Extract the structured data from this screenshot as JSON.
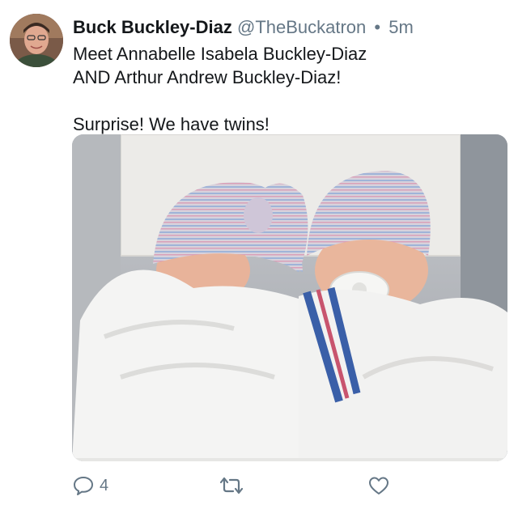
{
  "tweet": {
    "author": {
      "display_name": "Buck Buckley-Diaz",
      "handle": "@TheBuckatron",
      "separator": "•",
      "time": "5m"
    },
    "text": {
      "line1": "Meet Annabelle Isabela Buckley-Diaz",
      "line2": "AND Arthur Andrew Buckley-Diaz!",
      "line3": "Surprise! We have twins!"
    },
    "media": {
      "alt": "newborn twins swaddled in hospital blankets"
    },
    "actions": {
      "reply": {
        "icon": "reply-icon",
        "count": "4"
      },
      "retweet": {
        "icon": "retweet-icon"
      },
      "like": {
        "icon": "heart-icon"
      }
    }
  },
  "colors": {
    "text_primary": "#14171a",
    "text_secondary": "#657786",
    "background": "#ffffff"
  }
}
